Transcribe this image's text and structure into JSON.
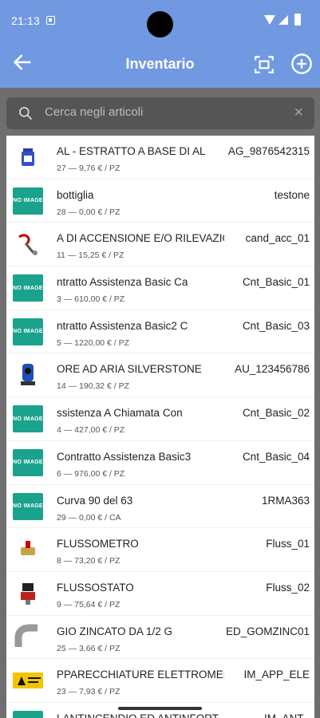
{
  "status": {
    "time": "21:13"
  },
  "appbar": {
    "title": "Inventario"
  },
  "search": {
    "placeholder": "Cerca negli articoli"
  },
  "items": [
    {
      "name": "AL - ESTRATTO A BASE DI AL",
      "code": "AG_9876542315",
      "sub": "27 — 9,76 € / PZ",
      "thumb": "bottle"
    },
    {
      "name": "bottiglia",
      "code": "testone",
      "sub": "28 — 0,00 € / PZ",
      "thumb": "noimg"
    },
    {
      "name": "A DI ACCENSIONE E/O RILEVAZIO",
      "code": "cand_acc_01",
      "sub": "11 — 15,25 € / PZ",
      "thumb": "igniter"
    },
    {
      "name": "ntratto Assistenza Basic      Ca",
      "code": "Cnt_Basic_01",
      "sub": "3 — 610,00 € / PZ",
      "thumb": "noimg"
    },
    {
      "name": "ntratto Assistenza Basic2       C",
      "code": "Cnt_Basic_03",
      "sub": "5 — 1220,00 € / PZ",
      "thumb": "noimg"
    },
    {
      "name": "ORE AD ARIA SILVERSTONE",
      "code": "AU_123456786",
      "sub": "14 — 190,32 € / PZ",
      "thumb": "compressor"
    },
    {
      "name": "ssistenza A Chiamata          Con",
      "code": "Cnt_Basic_02",
      "sub": "4 — 427,00 € / PZ",
      "thumb": "noimg"
    },
    {
      "name": "Contratto Assistenza Basic3",
      "code": "Cnt_Basic_04",
      "sub": "6 — 976,00 € / PZ",
      "thumb": "noimg"
    },
    {
      "name": "Curva 90 del 63",
      "code": "1RMA363",
      "sub": "29 — 0,00 € / CA",
      "thumb": "noimg"
    },
    {
      "name": "FLUSSOMETRO",
      "code": "Fluss_01",
      "sub": "8 — 73,20 € / PZ",
      "thumb": "valve"
    },
    {
      "name": "FLUSSOSTATO",
      "code": "Fluss_02",
      "sub": "9 — 75,64 € / PZ",
      "thumb": "flowswitch"
    },
    {
      "name": "GIO ZINCATO DA 1/2          G",
      "code": "ED_GOMZINC01",
      "sub": "25 — 3,66 € / PZ",
      "thumb": "elbow"
    },
    {
      "name": "PPARECCHIATURE ELETTROMED",
      "code": "IM_APP_ELE",
      "sub": "23 — 7,93 € / PZ",
      "thumb": "sign"
    },
    {
      "name": "LANTINCENDIO ED ANTINFORT",
      "code": "IM_ANT_",
      "sub": "",
      "thumb": "noimg"
    }
  ],
  "labels": {
    "noimg": "NO IMAGE"
  }
}
